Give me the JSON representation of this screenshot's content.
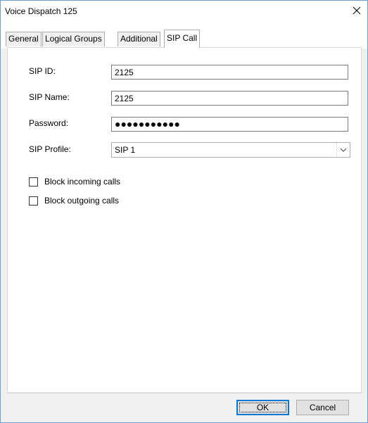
{
  "window": {
    "title": "Voice Dispatch 125",
    "close_icon": "close-icon"
  },
  "tabs": [
    {
      "label": "General",
      "active": false
    },
    {
      "label": "Logical Groups",
      "active": false
    },
    {
      "label": "Additional",
      "active": false
    },
    {
      "label": "SIP Call",
      "active": true
    }
  ],
  "form": {
    "sip_id_label": "SIP ID:",
    "sip_id_value": "2125",
    "sip_name_label": "SIP Name:",
    "sip_name_value": "2125",
    "password_label": "Password:",
    "password_value": "●●●●●●●●●●●",
    "sip_profile_label": "SIP Profile:",
    "sip_profile_value": "SIP 1",
    "block_incoming_label": "Block incoming calls",
    "block_incoming_checked": false,
    "block_outgoing_label": "Block outgoing calls",
    "block_outgoing_checked": false
  },
  "buttons": {
    "ok_label": "OK",
    "cancel_label": "Cancel"
  },
  "colors": {
    "accent": "#0078d7",
    "window_border": "#6d9ed6"
  }
}
